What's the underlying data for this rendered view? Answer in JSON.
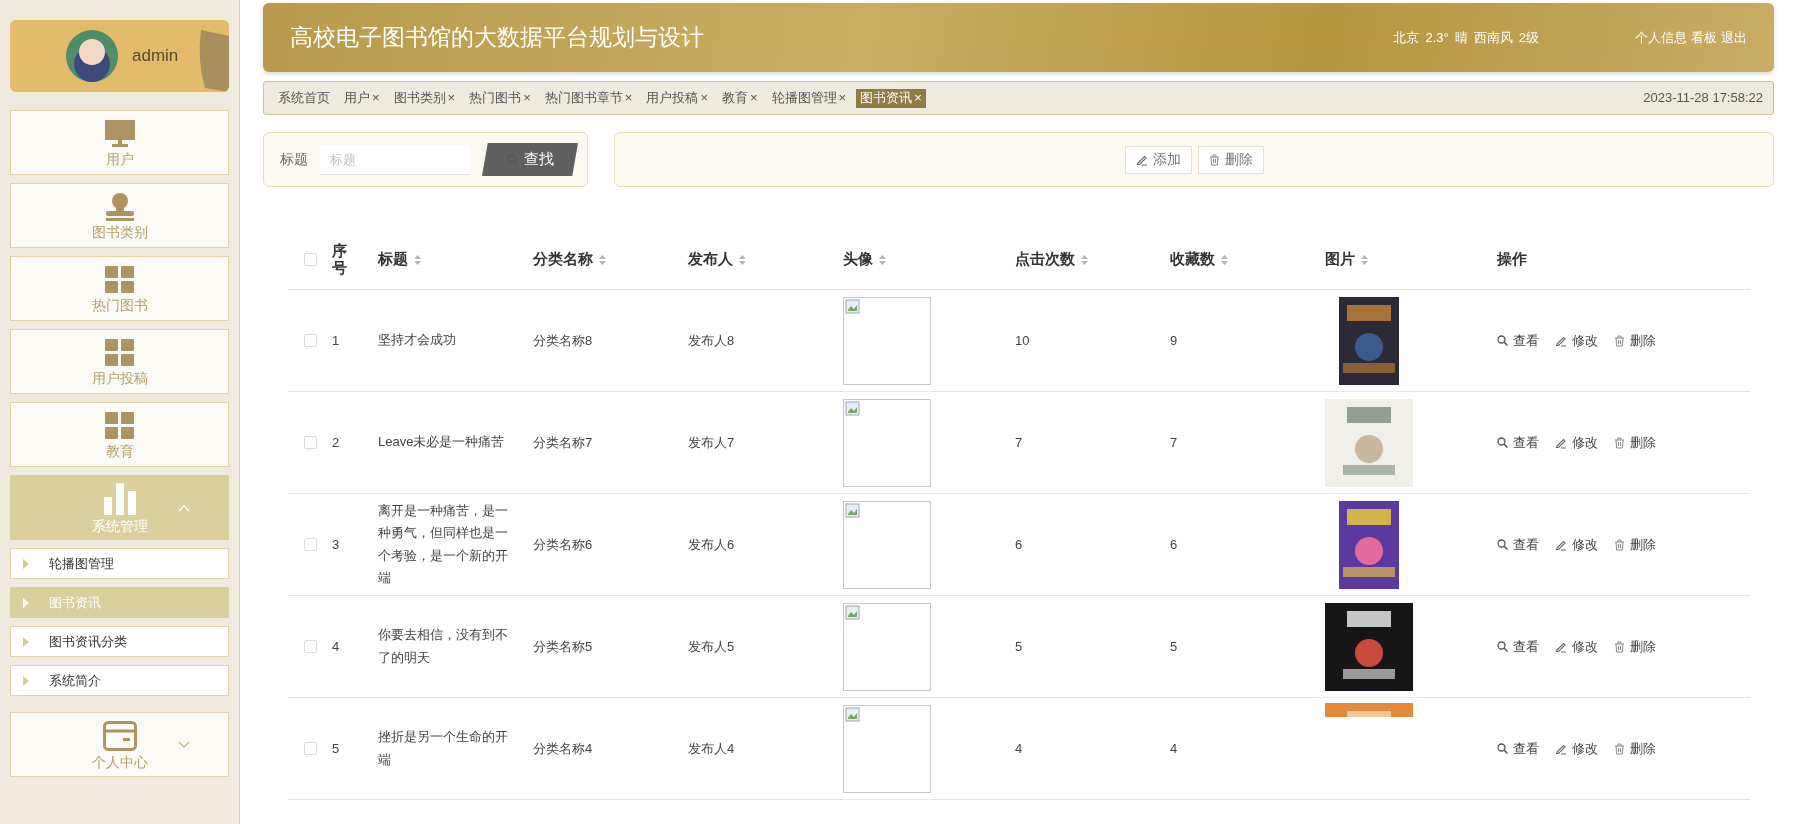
{
  "sidebar": {
    "user": {
      "name": "admin"
    },
    "items": [
      {
        "label": "用户",
        "kind": "monitor",
        "expanded": false
      },
      {
        "label": "图书类别",
        "kind": "stamp",
        "expanded": false
      },
      {
        "label": "热门图书",
        "kind": "grid",
        "expanded": false
      },
      {
        "label": "用户投稿",
        "kind": "grid",
        "expanded": false
      },
      {
        "label": "教育",
        "kind": "grid",
        "expanded": false
      },
      {
        "label": "系统管理",
        "kind": "chart",
        "expanded": true,
        "children": [
          {
            "label": "轮播图管理",
            "selected": false
          },
          {
            "label": "图书资讯",
            "selected": true
          },
          {
            "label": "图书资讯分类",
            "selected": false
          },
          {
            "label": "系统简介",
            "selected": false
          }
        ]
      },
      {
        "label": "个人中心",
        "kind": "card",
        "expanded": false
      }
    ]
  },
  "header": {
    "title": "高校电子图书馆的大数据平台规划与设计",
    "weather": [
      "北京",
      "2.3°",
      "晴",
      "西南风",
      "2级"
    ],
    "links": [
      "个人信息",
      "看板",
      "退出"
    ]
  },
  "tabs": [
    {
      "label": "系统首页",
      "selected": false
    },
    {
      "label": "用户",
      "close": "×",
      "selected": false
    },
    {
      "label": "图书类别",
      "close": "×",
      "selected": false
    },
    {
      "label": "热门图书",
      "close": "×",
      "selected": false
    },
    {
      "label": "热门图书章节",
      "close": "×",
      "selected": false
    },
    {
      "label": "用户投稿",
      "close": "×",
      "selected": false
    },
    {
      "label": "教育",
      "close": "×",
      "selected": false
    },
    {
      "label": "轮播图管理",
      "close": "×",
      "selected": false
    },
    {
      "label": "图书资讯",
      "close": "×",
      "selected": true
    }
  ],
  "datetime": "2023-11-28 17:58:22",
  "search": {
    "label": "标题",
    "placeholder": "标题",
    "button": "查找"
  },
  "toolbar": [
    {
      "kind": "add",
      "label": "添加"
    },
    {
      "kind": "delete",
      "label": "删除"
    }
  ],
  "table": {
    "select_all": {
      "checked": false
    },
    "columns": [
      {
        "label": "序号",
        "sortable": false
      },
      {
        "label": "标题",
        "sortable": true
      },
      {
        "label": "分类名称",
        "sortable": true
      },
      {
        "label": "发布人",
        "sortable": true
      },
      {
        "label": "头像",
        "sortable": true
      },
      {
        "label": "点击次数",
        "sortable": true
      },
      {
        "label": "收藏数",
        "sortable": true
      },
      {
        "label": "图片",
        "sortable": true
      },
      {
        "label": "操作",
        "sortable": false
      }
    ],
    "rows": [
      {
        "checked": false,
        "cells": [
          "1",
          "坚持才会成功",
          "分类名称8",
          "发布人8",
          null,
          "10",
          "9",
          null
        ],
        "actions": [
          {
            "kind": "view",
            "label": "查看"
          },
          {
            "kind": "edit",
            "label": "修改"
          },
          {
            "kind": "delete",
            "label": "删除"
          }
        ]
      },
      {
        "checked": false,
        "cells": [
          "2",
          "Leave未必是一种痛苦",
          "分类名称7",
          "发布人7",
          null,
          "7",
          "7",
          null
        ],
        "actions": [
          {
            "kind": "view",
            "label": "查看"
          },
          {
            "kind": "edit",
            "label": "修改"
          },
          {
            "kind": "delete",
            "label": "删除"
          }
        ]
      },
      {
        "checked": false,
        "cells": [
          "3",
          "离开是一种痛苦，是一种勇气，但同样也是一个考验，是一个新的开端",
          "分类名称6",
          "发布人6",
          null,
          "6",
          "6",
          null
        ],
        "actions": [
          {
            "kind": "view",
            "label": "查看"
          },
          {
            "kind": "edit",
            "label": "修改"
          },
          {
            "kind": "delete",
            "label": "删除"
          }
        ]
      },
      {
        "checked": false,
        "cells": [
          "4",
          "你要去相信，没有到不了的明天",
          "分类名称5",
          "发布人5",
          null,
          "5",
          "5",
          null
        ],
        "actions": [
          {
            "kind": "view",
            "label": "查看"
          },
          {
            "kind": "edit",
            "label": "修改"
          },
          {
            "kind": "delete",
            "label": "删除"
          }
        ]
      },
      {
        "checked": false,
        "cells": [
          "5",
          "挫折是另一个生命的开端",
          "分类名称4",
          "发布人4",
          null,
          "4",
          "4",
          null
        ],
        "actions": [
          {
            "kind": "view",
            "label": "查看"
          },
          {
            "kind": "edit",
            "label": "修改"
          },
          {
            "kind": "delete",
            "label": "删除"
          }
        ]
      }
    ]
  }
}
